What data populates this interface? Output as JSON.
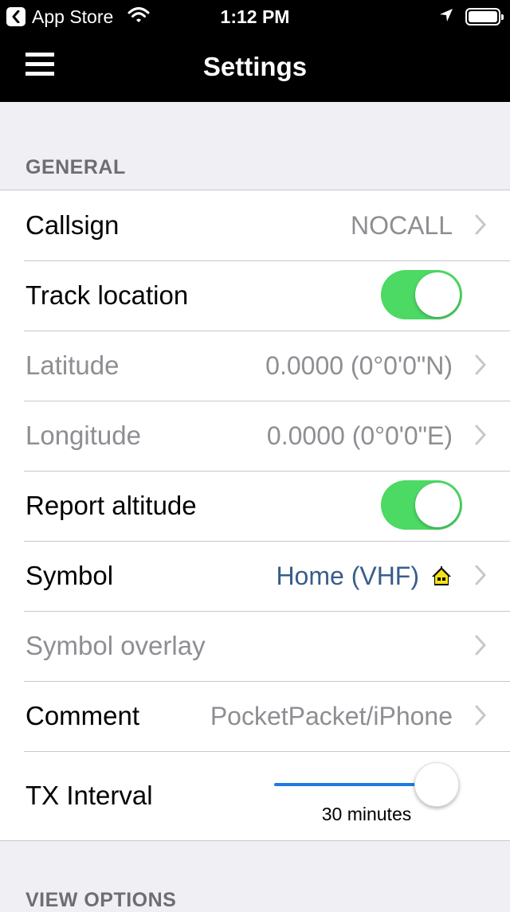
{
  "status_bar": {
    "back_app": "App Store",
    "time": "1:12 PM"
  },
  "navbar": {
    "title": "Settings"
  },
  "sections": {
    "general": "GENERAL",
    "view_options": "VIEW OPTIONS"
  },
  "rows": {
    "callsign": {
      "label": "Callsign",
      "value": "NOCALL"
    },
    "track_location": {
      "label": "Track location",
      "on": true
    },
    "latitude": {
      "label": "Latitude",
      "value": "0.0000 (0°0'0\"N)"
    },
    "longitude": {
      "label": "Longitude",
      "value": "0.0000 (0°0'0\"E)"
    },
    "report_altitude": {
      "label": "Report altitude",
      "on": true
    },
    "symbol": {
      "label": "Symbol",
      "value": "Home (VHF)",
      "icon": "house-icon"
    },
    "symbol_overlay": {
      "label": "Symbol overlay"
    },
    "comment": {
      "label": "Comment",
      "value": "PocketPacket/iPhone"
    },
    "tx_interval": {
      "label": "TX Interval",
      "value_text": "30 minutes",
      "slider_fraction": 1.0
    }
  },
  "colors": {
    "toggle_on": "#4cd964",
    "slider_fill": "#1d7be3",
    "link_value": "#385d8a"
  }
}
